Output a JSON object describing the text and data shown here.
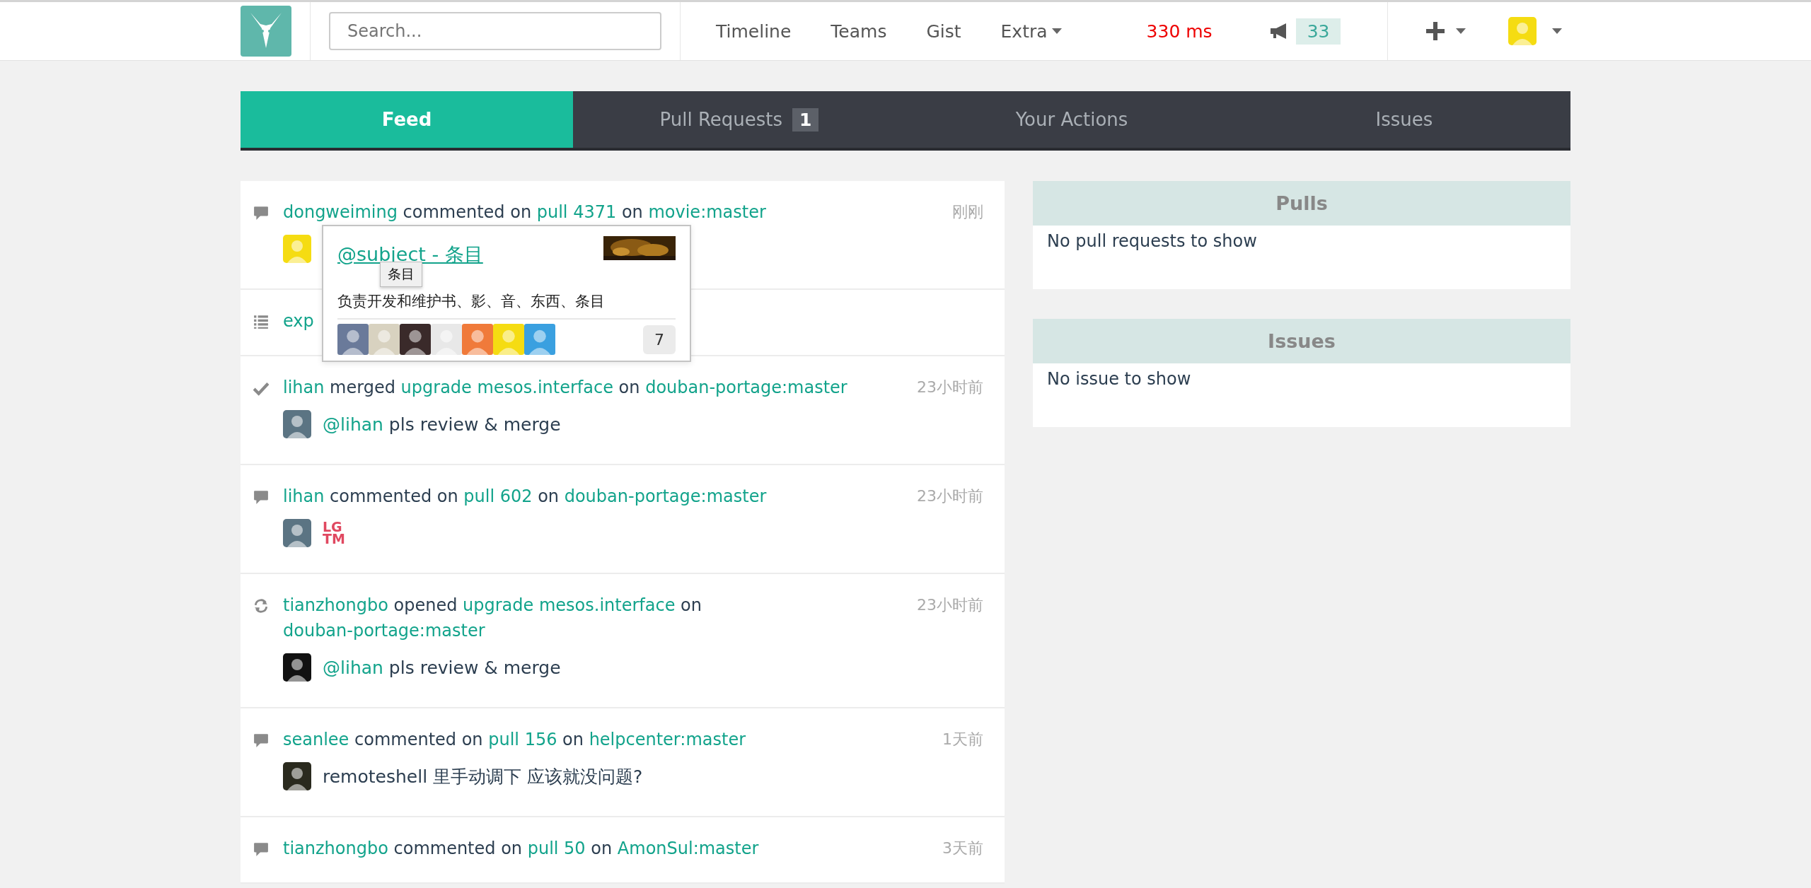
{
  "header": {
    "search": {
      "placeholder": "Search..."
    },
    "nav": [
      {
        "label": "Timeline",
        "dropdown": false
      },
      {
        "label": "Teams",
        "dropdown": false
      },
      {
        "label": "Gist",
        "dropdown": false
      },
      {
        "label": "Extra",
        "dropdown": true
      }
    ],
    "latency": "330 ms",
    "notifications": "33"
  },
  "tabs": [
    {
      "label": "Feed",
      "selected": true
    },
    {
      "label": "Pull Requests",
      "selected": false,
      "badge": "1"
    },
    {
      "label": "Your Actions",
      "selected": false
    },
    {
      "label": "Issues",
      "selected": false
    }
  ],
  "feed": [
    {
      "kind": "comment",
      "parts": [
        {
          "text": "dongweiming",
          "link": true
        },
        {
          "text": "commented on",
          "link": false
        },
        {
          "text": "pull 4371",
          "link": true
        },
        {
          "text": "on",
          "link": false
        },
        {
          "text": "movie:master",
          "link": true
        }
      ],
      "time": "刚刚",
      "body": {
        "kind": "avatar"
      }
    },
    {
      "kind": "list",
      "parts": [
        {
          "text": "exp",
          "link": true
        }
      ]
    },
    {
      "kind": "check",
      "parts": [
        {
          "text": "lihan",
          "link": true
        },
        {
          "text": "merged",
          "link": false
        },
        {
          "text": "upgrade mesos.interface",
          "link": true
        },
        {
          "text": "on",
          "link": false
        },
        {
          "text": "douban-portage:master",
          "link": true
        }
      ],
      "time": "23小时前",
      "body": {
        "kind": "text",
        "parts": [
          {
            "text": "@lihan",
            "link": true
          },
          {
            "text": "pls review & merge",
            "link": false
          }
        ]
      }
    },
    {
      "kind": "comment",
      "parts": [
        {
          "text": "lihan",
          "link": true
        },
        {
          "text": "commented on",
          "link": false
        },
        {
          "text": "pull 602",
          "link": true
        },
        {
          "text": "on",
          "link": false
        },
        {
          "text": "douban-portage:master",
          "link": true
        }
      ],
      "time": "23小时前",
      "body": {
        "kind": "lgtm",
        "lines": [
          "LG",
          "TM"
        ]
      }
    },
    {
      "kind": "sync",
      "parts": [
        {
          "text": "tianzhongbo",
          "link": true
        },
        {
          "text": "opened",
          "link": false
        },
        {
          "text": "upgrade mesos.interface",
          "link": true
        },
        {
          "text": "on",
          "link": false
        },
        {
          "text": "douban-portage:master",
          "link": true
        }
      ],
      "time": "23小时前",
      "body": {
        "kind": "text",
        "parts": [
          {
            "text": "@lihan",
            "link": true
          },
          {
            "text": "pls review & merge",
            "link": false
          }
        ]
      }
    },
    {
      "kind": "comment",
      "parts": [
        {
          "text": "seanlee",
          "link": true
        },
        {
          "text": "commented on",
          "link": false
        },
        {
          "text": "pull 156",
          "link": true
        },
        {
          "text": "on",
          "link": false
        },
        {
          "text": "helpcenter:master",
          "link": true
        }
      ],
      "time": "1天前",
      "body": {
        "kind": "text",
        "parts": [
          {
            "text": "remoteshell 里手动调下 应该就没问题?",
            "link": false
          }
        ]
      }
    },
    {
      "kind": "comment",
      "parts": [
        {
          "text": "tianzhongbo",
          "link": true
        },
        {
          "text": "commented on",
          "link": false
        },
        {
          "text": "pull 50",
          "link": true
        },
        {
          "text": "on",
          "link": false
        },
        {
          "text": "AmonSul:master",
          "link": true
        }
      ],
      "time": "3天前"
    }
  ],
  "popup": {
    "title": "@subject - 条目",
    "tooltip": "条目",
    "description": "负责开发和维护书、影、音、东西、条目",
    "members": [
      {
        "color": "#6a7a9a"
      },
      {
        "color": "#d8d2c0"
      },
      {
        "color": "#3a2a2a"
      },
      {
        "color": "#e8e8e8"
      },
      {
        "color": "#f07a3a"
      },
      {
        "color": "#f5dc12"
      },
      {
        "color": "#3aa0e0"
      }
    ],
    "count": "7"
  },
  "panels": [
    {
      "title": "Pulls",
      "message": "No pull requests to show"
    },
    {
      "title": "Issues",
      "message": "No issue to show"
    }
  ]
}
